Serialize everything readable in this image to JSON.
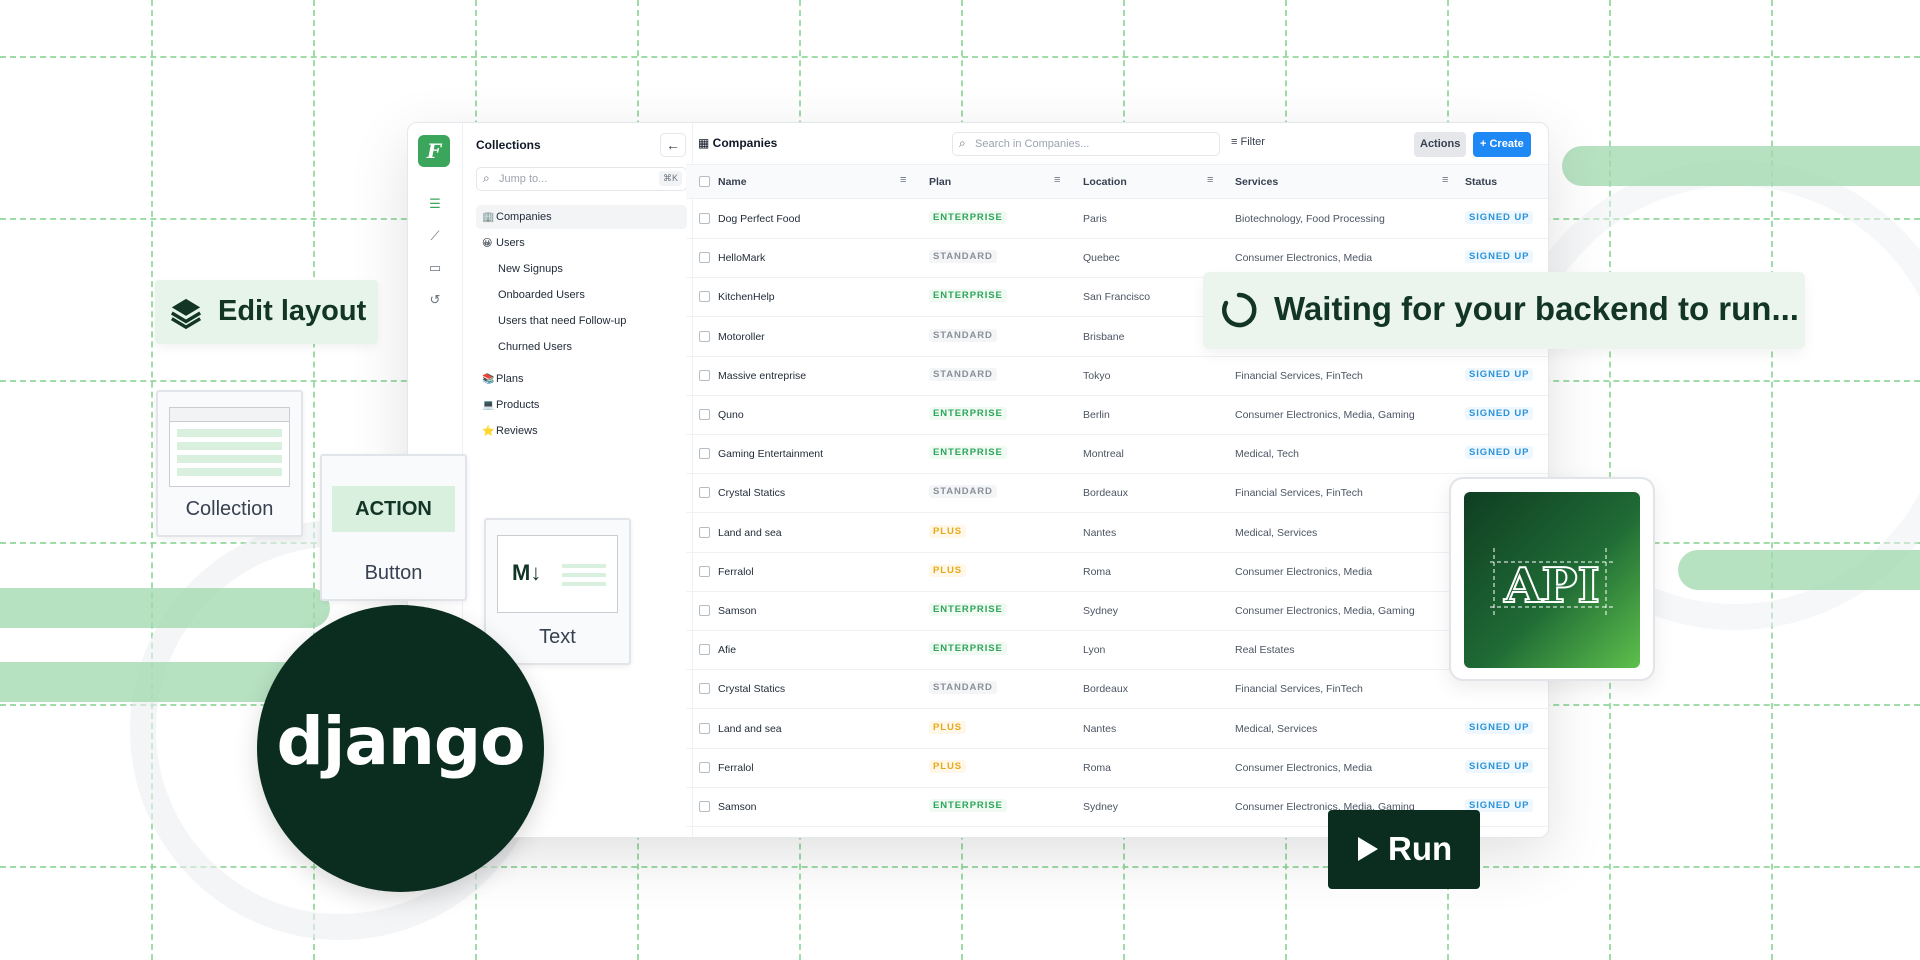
{
  "sidebar": {
    "collections_title": "Collections",
    "jump_placeholder": "Jump to...",
    "jump_shortcut": "⌘K",
    "items": [
      {
        "label": "Companies",
        "icon": "🏢",
        "active": true
      },
      {
        "label": "Users",
        "icon": "😀"
      },
      {
        "label": "New Signups",
        "sub": true
      },
      {
        "label": "Onboarded Users",
        "sub": true
      },
      {
        "label": "Users that need Follow-up",
        "sub": true
      },
      {
        "label": "Churned Users",
        "sub": true
      },
      {
        "label": "Plans",
        "icon": "📚"
      },
      {
        "label": "Products",
        "icon": "💻"
      },
      {
        "label": "Reviews",
        "icon": "⭐"
      }
    ]
  },
  "header": {
    "title": "Companies",
    "search_placeholder": "Search in Companies...",
    "filter_label": "Filter",
    "actions_label": "Actions",
    "create_label": "+ Create"
  },
  "table": {
    "columns": [
      "Name",
      "Plan",
      "Location",
      "Services",
      "Status"
    ],
    "rows": [
      {
        "name": "Dog Perfect Food",
        "plan": "ENTERPRISE",
        "location": "Paris",
        "services": "Biotechnology, Food Processing",
        "status": "SIGNED UP"
      },
      {
        "name": "HelloMark",
        "plan": "STANDARD",
        "location": "Quebec",
        "services": "Consumer Electronics, Media",
        "status": "SIGNED UP"
      },
      {
        "name": "KitchenHelp",
        "plan": "ENTERPRISE",
        "location": "San Francisco",
        "services": "",
        "status": ""
      },
      {
        "name": "Motoroller",
        "plan": "STANDARD",
        "location": "Brisbane",
        "services": "",
        "status": ""
      },
      {
        "name": "Massive entreprise",
        "plan": "STANDARD",
        "location": "Tokyo",
        "services": "Financial Services, FinTech",
        "status": "SIGNED UP"
      },
      {
        "name": "Quno",
        "plan": "ENTERPRISE",
        "location": "Berlin",
        "services": "Consumer Electronics, Media, Gaming",
        "status": "SIGNED UP"
      },
      {
        "name": "Gaming Entertainment",
        "plan": "ENTERPRISE",
        "location": "Montreal",
        "services": "Medical, Tech",
        "status": "SIGNED UP"
      },
      {
        "name": "Crystal Statics",
        "plan": "STANDARD",
        "location": "Bordeaux",
        "services": "Financial Services, FinTech",
        "status": ""
      },
      {
        "name": "Land and sea",
        "plan": "PLUS",
        "location": "Nantes",
        "services": "Medical, Services",
        "status": ""
      },
      {
        "name": "Ferralol",
        "plan": "PLUS",
        "location": "Roma",
        "services": "Consumer Electronics, Media",
        "status": ""
      },
      {
        "name": "Samson",
        "plan": "ENTERPRISE",
        "location": "Sydney",
        "services": "Consumer Electronics, Media, Gaming",
        "status": ""
      },
      {
        "name": "Afie",
        "plan": "ENTERPRISE",
        "location": "Lyon",
        "services": "Real Estates",
        "status": ""
      },
      {
        "name": "Crystal Statics",
        "plan": "STANDARD",
        "location": "Bordeaux",
        "services": "Financial Services, FinTech",
        "status": ""
      },
      {
        "name": "Land and sea",
        "plan": "PLUS",
        "location": "Nantes",
        "services": "Medical, Services",
        "status": "SIGNED UP"
      },
      {
        "name": "Ferralol",
        "plan": "PLUS",
        "location": "Roma",
        "services": "Consumer Electronics, Media",
        "status": "SIGNED UP"
      },
      {
        "name": "Samson",
        "plan": "ENTERPRISE",
        "location": "Sydney",
        "services": "Consumer Electronics, Media, Gaming",
        "status": "SIGNED UP"
      }
    ]
  },
  "overlays": {
    "edit_layout": "Edit layout",
    "collection_card": "Collection",
    "button_card_label": "Button",
    "button_card_action": "ACTION",
    "text_card_label": "Text",
    "text_card_md": "M↓",
    "waiting": "Waiting for your backend to run...",
    "api": "API",
    "django": "django",
    "run": "Run"
  },
  "colors": {
    "brand_green": "#3ba55c",
    "dark_green": "#0b2d1f",
    "create_blue": "#1e88f5",
    "status_blue": "#2b93d8"
  }
}
